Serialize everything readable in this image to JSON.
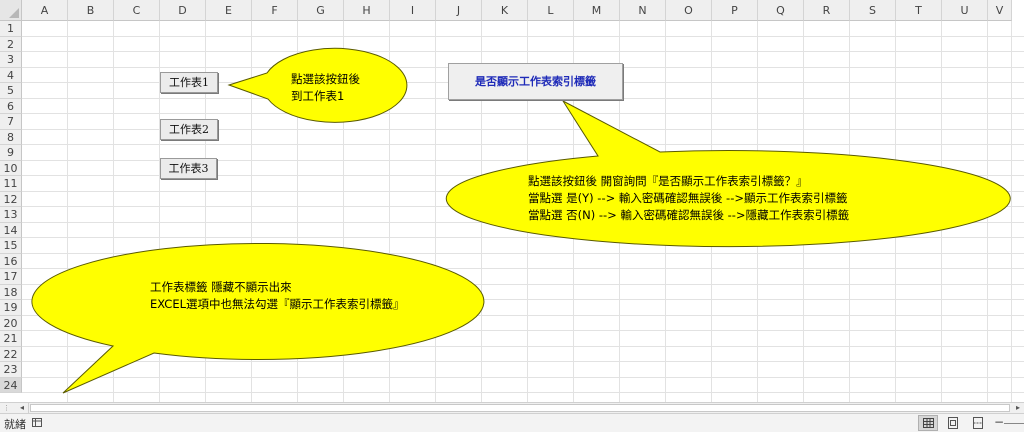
{
  "columns": [
    "A",
    "B",
    "C",
    "D",
    "E",
    "F",
    "G",
    "H",
    "I",
    "J",
    "K",
    "L",
    "M",
    "N",
    "O",
    "P",
    "Q",
    "R",
    "S",
    "T",
    "U",
    "V"
  ],
  "rows": [
    "1",
    "2",
    "3",
    "4",
    "5",
    "6",
    "7",
    "8",
    "9",
    "10",
    "11",
    "12",
    "13",
    "14",
    "15",
    "16",
    "17",
    "18",
    "19",
    "20",
    "21",
    "22",
    "23",
    "24"
  ],
  "buttons": {
    "sheet1": "工作表1",
    "sheet2": "工作表2",
    "sheet3": "工作表3",
    "toggle_tabs": "是否顯示工作表索引標籤"
  },
  "callouts": {
    "top_left": [
      "點選該按鈕後",
      "到工作表1"
    ],
    "right": [
      "點選該按鈕後 開窗詢問『是否顯示工作表索引標籤？』",
      "當點選 是(Y)  --> 輸入密碼確認無誤後 -->顯示工作表索引標籤",
      "當點選 否(N)  --> 輸入密碼確認無誤後 -->隱藏工作表索引標籤"
    ],
    "bottom": [
      "工作表標籤 隱藏不顯示出來",
      "EXCEL選項中也無法勾選『顯示工作表索引標籤』"
    ]
  },
  "callout_color": "#ffff00",
  "status": {
    "ready": "就緒"
  },
  "icons": [
    "sheet-layout-icon",
    "normal-view-icon",
    "page-layout-view-icon",
    "page-break-view-icon",
    "zoom-minus-icon"
  ]
}
